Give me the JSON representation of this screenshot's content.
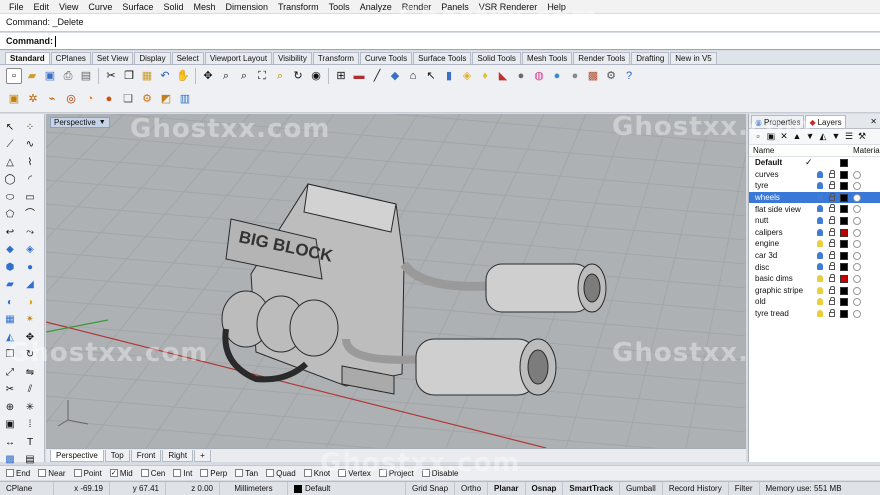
{
  "menu": [
    "File",
    "Edit",
    "View",
    "Curve",
    "Surface",
    "Solid",
    "Mesh",
    "Dimension",
    "Transform",
    "Tools",
    "Analyze",
    "Render",
    "Panels",
    "VSR Renderer",
    "Help"
  ],
  "command": {
    "history": "Command: _Delete",
    "prompt": "Command:"
  },
  "toolbar_tabs": [
    "Standard",
    "CPlanes",
    "Set View",
    "Display",
    "Select",
    "Viewport Layout",
    "Visibility",
    "Transform",
    "Curve Tools",
    "Surface Tools",
    "Solid Tools",
    "Mesh Tools",
    "Render Tools",
    "Drafting",
    "New in V5"
  ],
  "viewport": {
    "title": "Perspective",
    "tabs": [
      "Perspective",
      "Top",
      "Front",
      "Right"
    ],
    "add_tab": "+"
  },
  "panel": {
    "tabs": [
      "Properties",
      "Layers"
    ],
    "header": {
      "name": "Name",
      "material": "Material"
    },
    "layers": [
      {
        "name": "Default",
        "current": true,
        "check": "✓",
        "color": "#000000"
      },
      {
        "name": "curves",
        "bulb": "blue",
        "color": "#000000"
      },
      {
        "name": "tyre",
        "bulb": "blue",
        "color": "#000000"
      },
      {
        "name": "wheels",
        "bulb": "blue",
        "color": "#000000",
        "selected": true
      },
      {
        "name": "flat side view",
        "bulb": "blue",
        "color": "#000000"
      },
      {
        "name": "nutt",
        "bulb": "blue",
        "color": "#000000"
      },
      {
        "name": "calipers",
        "bulb": "blue",
        "color": "#c00000"
      },
      {
        "name": "engine",
        "bulb": "yellow",
        "color": "#000000"
      },
      {
        "name": "car 3d",
        "bulb": "blue",
        "color": "#000000"
      },
      {
        "name": "disc",
        "bulb": "blue",
        "color": "#000000"
      },
      {
        "name": "basic dims",
        "bulb": "yellow",
        "color": "#d00000"
      },
      {
        "name": "graphic stripe",
        "bulb": "yellow",
        "color": "#000000"
      },
      {
        "name": "old",
        "bulb": "yellow",
        "color": "#000000"
      },
      {
        "name": "tyre tread",
        "bulb": "yellow",
        "color": "#000000"
      }
    ]
  },
  "model_label": "BIG BLOCK",
  "osnaps": [
    {
      "label": "End",
      "checked": false
    },
    {
      "label": "Near",
      "checked": false
    },
    {
      "label": "Point",
      "checked": false
    },
    {
      "label": "Mid",
      "checked": true
    },
    {
      "label": "Cen",
      "checked": false
    },
    {
      "label": "Int",
      "checked": false
    },
    {
      "label": "Perp",
      "checked": false
    },
    {
      "label": "Tan",
      "checked": false
    },
    {
      "label": "Quad",
      "checked": false
    },
    {
      "label": "Knot",
      "checked": false
    },
    {
      "label": "Vertex",
      "checked": false
    },
    {
      "label": "Project",
      "checked": false
    },
    {
      "label": "Disable",
      "checked": false
    }
  ],
  "status": {
    "cplane": "CPlane",
    "x": "x -69.19",
    "y": "y 67.41",
    "z": "z 0.00",
    "units": "Millimeters",
    "layer": "Default",
    "grid_snap": "Grid Snap",
    "ortho": "Ortho",
    "planar": "Planar",
    "osnap": "Osnap",
    "smarttrack": "SmartTrack",
    "gumball": "Gumball",
    "record_history": "Record History",
    "filter": "Filter",
    "memory": "Memory use: 551 MB"
  },
  "watermark": "Ghostxx.com",
  "colors": {
    "selection": "#3a78d8",
    "viewport_bg": "#aeb1b4",
    "grid": "#a3a6a9",
    "x_axis": "#b03a3a",
    "y_axis": "#3a9a3a"
  }
}
